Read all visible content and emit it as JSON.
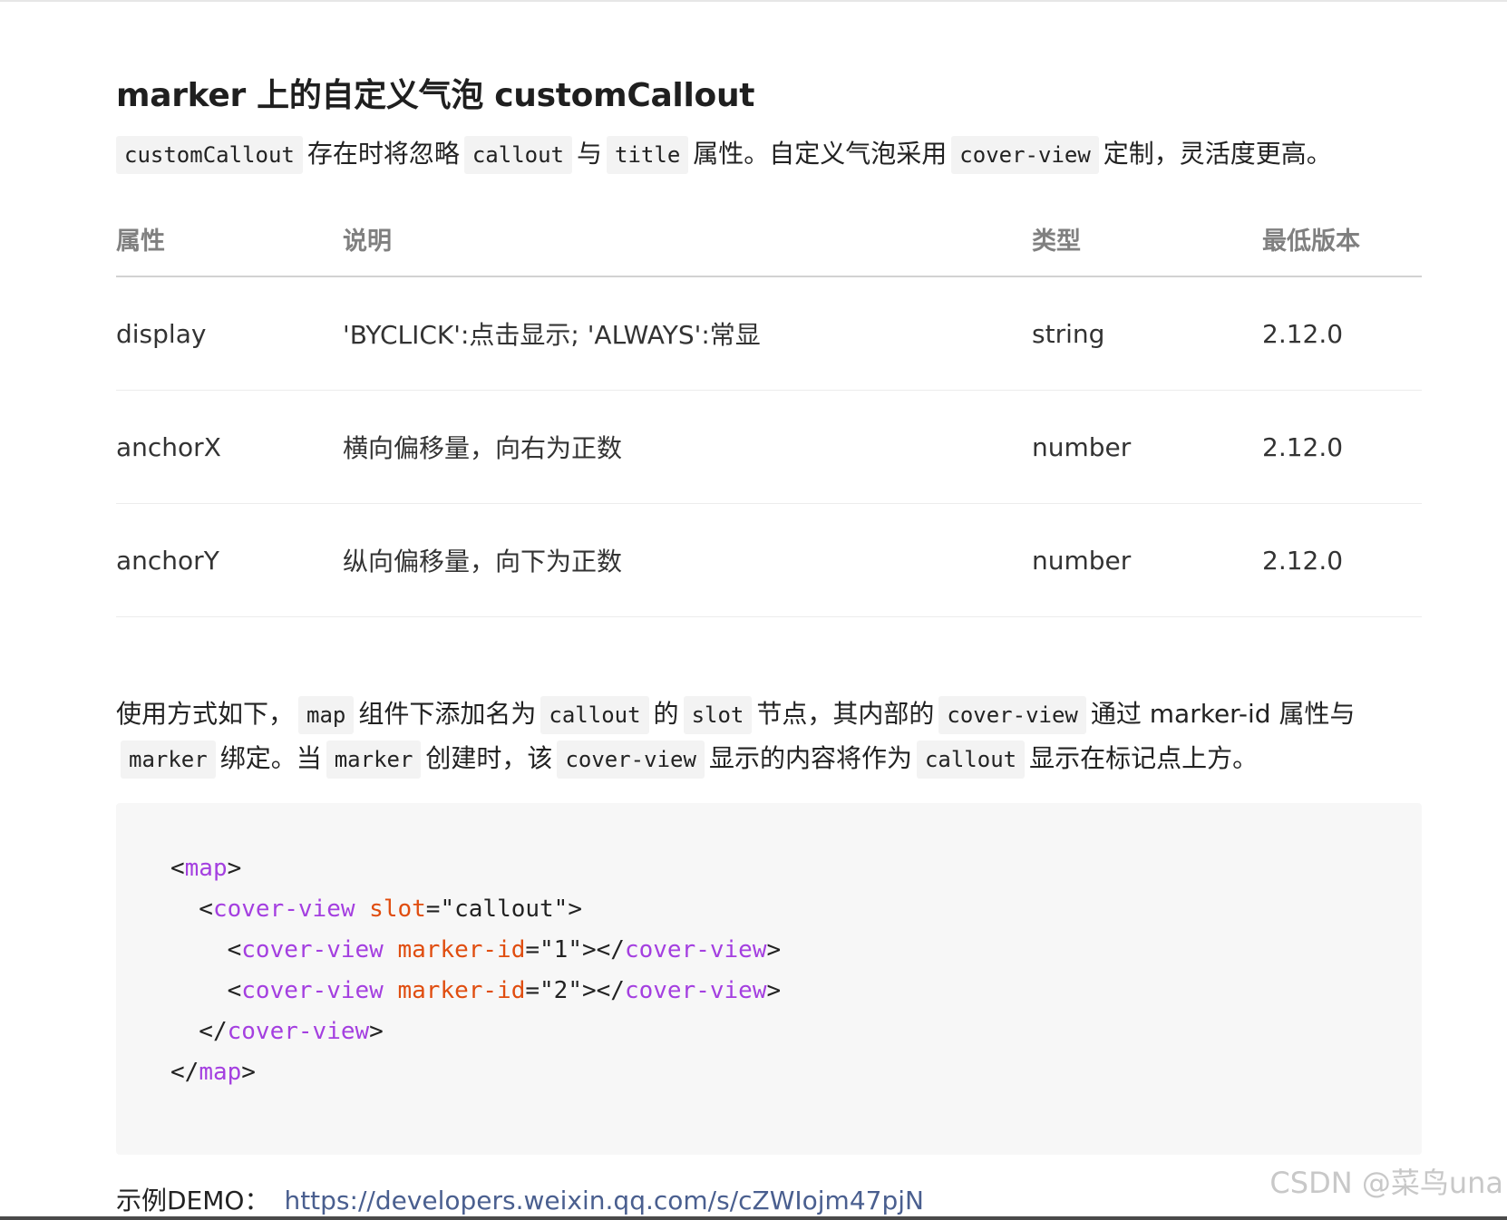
{
  "heading": "marker 上的自定义气泡 customCallout",
  "intro": {
    "code1": "customCallout",
    "text1": "存在时将忽略",
    "code2": "callout",
    "text2": "与",
    "code3": "title",
    "text3": "属性。自定义气泡采用",
    "code4": "cover-view",
    "text4": "定制，灵活度更高。"
  },
  "table": {
    "headers": [
      "属性",
      "说明",
      "类型",
      "最低版本"
    ],
    "rows": [
      {
        "attr": "display",
        "desc": "'BYCLICK':点击显示; 'ALWAYS':常显",
        "type": "string",
        "version": "2.12.0"
      },
      {
        "attr": "anchorX",
        "desc": "横向偏移量，向右为正数",
        "type": "number",
        "version": "2.12.0"
      },
      {
        "attr": "anchorY",
        "desc": "纵向偏移量，向下为正数",
        "type": "number",
        "version": "2.12.0"
      }
    ]
  },
  "usage": {
    "t1": "使用方式如下，",
    "c1": "map",
    "t2": "组件下添加名为",
    "c2": "callout",
    "t3": "的",
    "c3": "slot",
    "t4": "节点，其内部的",
    "c4": "cover-view",
    "t5": "通过 marker-id 属性与",
    "c5": "marker",
    "t6": "绑定。当",
    "c6": "marker",
    "t7": "创建时，该",
    "c7": "cover-view",
    "t8": "显示的内容将作为",
    "c8": "callout",
    "t9": "显示在标记点上方。"
  },
  "code": {
    "lines": [
      {
        "parts": [
          [
            "p",
            "<"
          ],
          [
            "t",
            "map"
          ],
          [
            "p",
            ">"
          ]
        ]
      },
      {
        "parts": [
          [
            "p",
            "  <"
          ],
          [
            "t",
            "cover-view"
          ],
          [
            "p",
            " "
          ],
          [
            "a",
            "slot"
          ],
          [
            "p",
            "=\"callout\">"
          ]
        ]
      },
      {
        "parts": [
          [
            "p",
            "    <"
          ],
          [
            "t",
            "cover-view"
          ],
          [
            "p",
            " "
          ],
          [
            "a",
            "marker-id"
          ],
          [
            "p",
            "=\"1\"></"
          ],
          [
            "t",
            "cover-view"
          ],
          [
            "p",
            ">"
          ]
        ]
      },
      {
        "parts": [
          [
            "p",
            "    <"
          ],
          [
            "t",
            "cover-view"
          ],
          [
            "p",
            " "
          ],
          [
            "a",
            "marker-id"
          ],
          [
            "p",
            "=\"2\"></"
          ],
          [
            "t",
            "cover-view"
          ],
          [
            "p",
            ">"
          ]
        ]
      },
      {
        "parts": [
          [
            "p",
            "  </"
          ],
          [
            "t",
            "cover-view"
          ],
          [
            "p",
            ">"
          ]
        ]
      },
      {
        "parts": [
          [
            "p",
            "</"
          ],
          [
            "t",
            "map"
          ],
          [
            "p",
            ">"
          ]
        ]
      }
    ]
  },
  "demo": {
    "label": "示例DEMO：",
    "link": "https://developers.weixin.qq.com/s/cZWIojm47pjN"
  },
  "watermark": "CSDN @菜鸟una"
}
